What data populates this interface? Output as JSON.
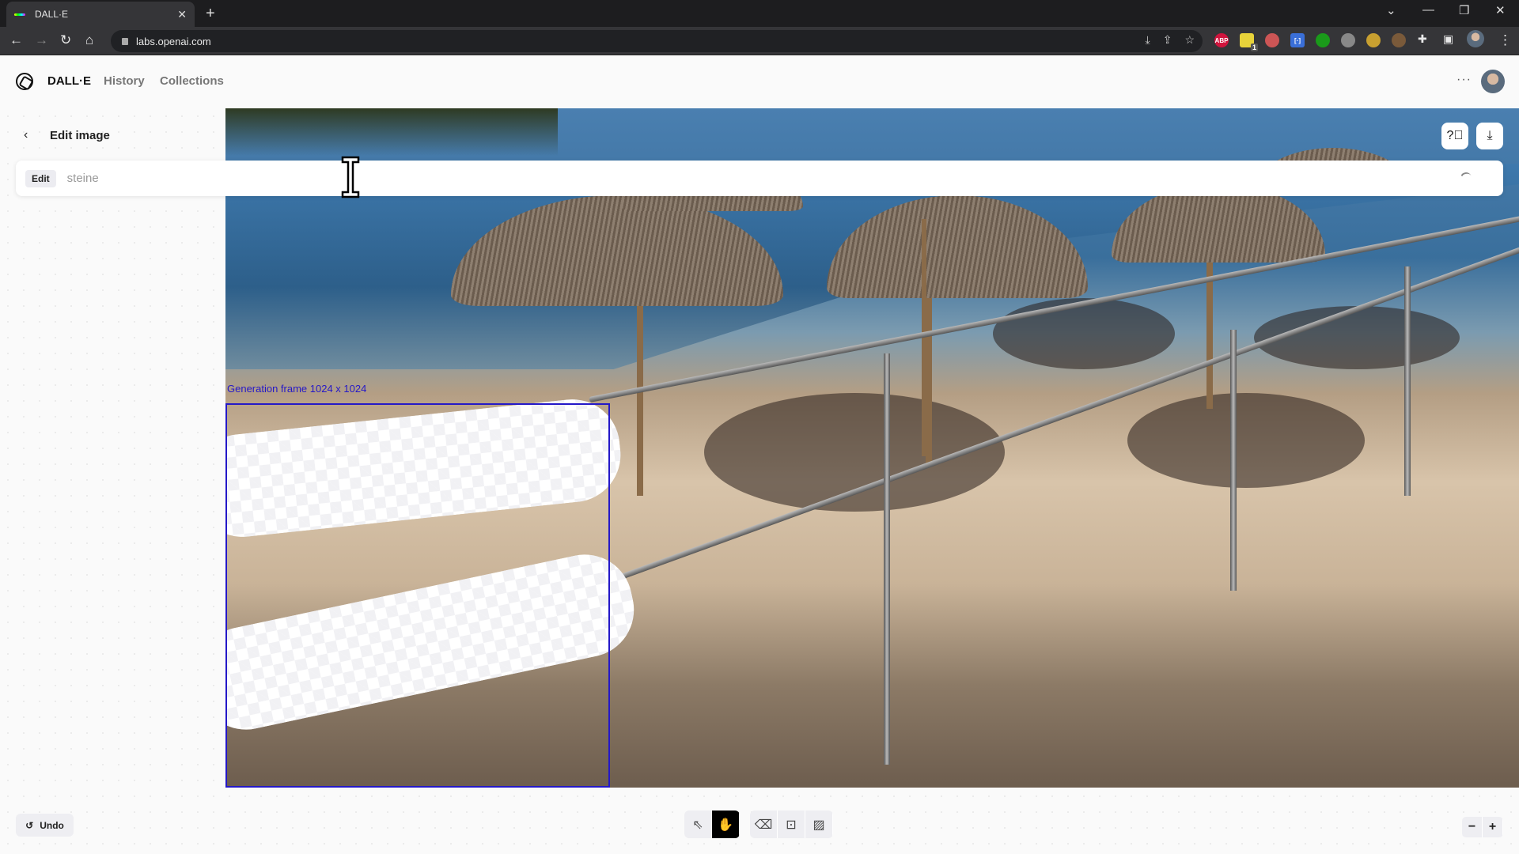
{
  "browser": {
    "tab_title": "DALL·E",
    "url": "labs.openai.com",
    "extensions": [
      {
        "name": "abp",
        "label": "ABP",
        "color": "#d0143d"
      },
      {
        "name": "yellow-ext",
        "label": "",
        "color": "#e8d33a",
        "badge": "1"
      },
      {
        "name": "rainbow-ext",
        "label": "",
        "color": "#c55"
      },
      {
        "name": "bracket-ext",
        "label": "[·]",
        "color": "#3a6fd8"
      },
      {
        "name": "download-ext",
        "label": "",
        "color": "#1a9a1a"
      },
      {
        "name": "camera-ext",
        "label": "",
        "color": "#888"
      },
      {
        "name": "globe-ext",
        "label": "",
        "color": "#c8a030"
      },
      {
        "name": "cookie-ext",
        "label": "",
        "color": "#7a5a3a"
      }
    ]
  },
  "app": {
    "brand": "DALL·E",
    "nav": [
      "History",
      "Collections"
    ],
    "more_label": "···"
  },
  "editor": {
    "title": "Edit image",
    "mode_chip": "Edit",
    "prompt_value": "steine",
    "frame_label": "Generation frame 1024 x 1024",
    "undo_label": "Undo",
    "tools": [
      {
        "name": "select",
        "glyph": "⇖",
        "active": false
      },
      {
        "name": "pan",
        "glyph": "✋",
        "active": true
      }
    ],
    "tools2": [
      {
        "name": "eraser",
        "glyph": "⌫"
      },
      {
        "name": "add-frame",
        "glyph": "⊡"
      },
      {
        "name": "upload-image",
        "glyph": "▨"
      }
    ],
    "zoom_out": "−",
    "zoom_in": "+"
  }
}
